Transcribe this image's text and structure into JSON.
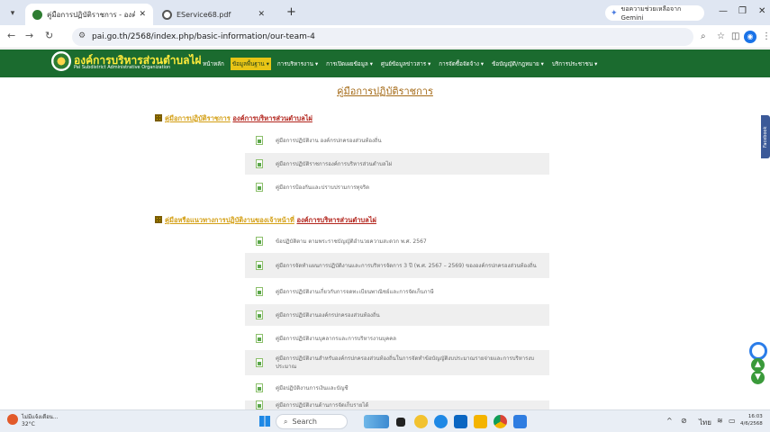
{
  "browser": {
    "tabs": [
      {
        "title": "คู่มือการปฏิบัติราชการ - องค์การบริ",
        "active": true
      },
      {
        "title": "EService68.pdf",
        "active": false
      }
    ],
    "gemini_label": "ขอความช่วยเหลือจาก Gemini",
    "url": "pai.go.th/2568/index.php/basic-information/our-team-4"
  },
  "site": {
    "name": "องค์การบริหารส่วนตำบลไผ่",
    "name_en": "Pai Subdistrict Administrative Organization",
    "nav": [
      {
        "label": "หน้าหลัก",
        "highlight": false
      },
      {
        "label": "ข้อมูลพื้นฐาน ▾",
        "highlight": true
      },
      {
        "label": "การบริหารงาน ▾",
        "highlight": false
      },
      {
        "label": "การเปิดเผยข้อมูล ▾",
        "highlight": false
      },
      {
        "label": "ศูนย์ข้อมูลข่าวสาร ▾",
        "highlight": false
      },
      {
        "label": "การจัดซื้อจัดจ้าง ▾",
        "highlight": false
      },
      {
        "label": "ข้อบัญญัติ/กฎหมาย ▾",
        "highlight": false
      },
      {
        "label": "บริการประชาชน ▾",
        "highlight": false
      }
    ]
  },
  "content": {
    "page_title": "คู่มือการปฏิบัติราชการ",
    "sections": [
      {
        "title_a": "คู่มือการปฏิบัติราชการ",
        "title_b": "องค์การบริหารส่วนตำบลไผ่",
        "items": [
          "คู่มือการปฏิบัติงาน องค์กรปกครองส่วนท้องถิ่น",
          "คู่มือการปฏิบัติราชการองค์การบริหารส่วนตำบลไผ่",
          "คู่มือการป้องกันและปราบปรามการทุจริต"
        ]
      },
      {
        "title_a": "คู่มือหรือแนวทางการปฏิบัติงานของเจ้าหน้าที่",
        "title_b": "องค์การบริหารส่วนตำบลไผ่",
        "items": [
          "ข้อปฏิบัติตาม ตามพระราชบัญญัติอำนวยความสะดวก พ.ศ. 2567",
          "คู่มือการจัดทำแผนการปฏิบัติงานและการบริหารจัดการ 3 ปี (พ.ศ. 2567 – 2569) ขององค์กรปกครองส่วนท้องถิ่น",
          "คู่มือการปฏิบัติงานเกี่ยวกับการจดทะเบียนพาณิชย์และการจัดเก็บภาษี",
          "คู่มือการปฏิบัติงานองค์กรปกครองส่วนท้องถิ่น",
          "คู่มือการปฏิบัติงานบุคลากรและการบริหารงานบุคคล",
          "คู่มือการปฏิบัติงานสำหรับองค์กรปกครองส่วนท้องถิ่นในการจัดทำข้อบัญญัติงบประมาณรายจ่ายและการบริหารงบประมาณ",
          "คู่มือปฏิบัติงานการเงินและบัญชี",
          "คู่มือการปฏิบัติงานด้านการจัดเก็บรายได้"
        ]
      }
    ],
    "facebook_tab": "Facebook"
  },
  "taskbar": {
    "weather_text": "ไม่มีแจ้งเตือน...",
    "temperature": "32°C",
    "search_placeholder": "Search",
    "lang": "ไทย",
    "time": "16:03",
    "date": "4/6/2568"
  },
  "colors": {
    "header_green": "#1b6b2f",
    "title_brown": "#a56b18",
    "section_gold": "#d4a017",
    "section_red": "#b3261e"
  }
}
